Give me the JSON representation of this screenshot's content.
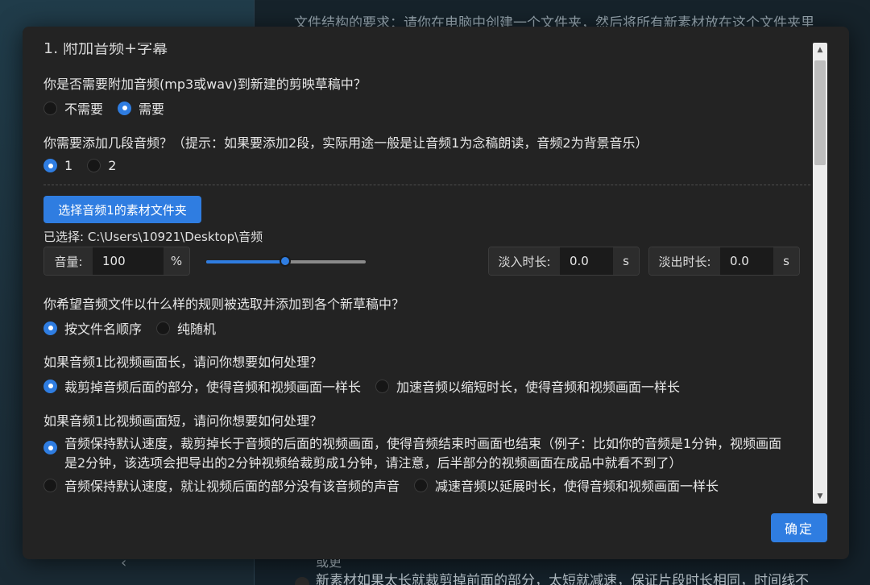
{
  "background": {
    "top_text": "文件结构的要求：请你在电脑中创建一个文件夹，然后将所有新素材放在这个文件夹里",
    "bottom_text_1": "或更",
    "bottom_text_2": "新素材如果太长就裁剪掉前面的部分，太短就减速，保证片段时长相同，时间线不"
  },
  "dialog": {
    "section_title": "1. 附加音频+字幕",
    "q_attach": "你是否需要附加音频(mp3或wav)到新建的剪映草稿中？",
    "attach_options": [
      {
        "label": "不需要",
        "selected": false
      },
      {
        "label": "需要",
        "selected": true
      }
    ],
    "q_count": "你需要添加几段音频？（提示：如果要添加2段，实际用途一般是让音频1为念稿朗读，音频2为背景音乐）",
    "count_options": [
      {
        "label": "1",
        "selected": true
      },
      {
        "label": "2",
        "selected": false
      }
    ],
    "select_folder_button": "选择音频1的素材文件夹",
    "selected_path": "已选择: C:\\Users\\10921\\Desktop\\音频",
    "volume": {
      "label": "音量:",
      "value": "100",
      "unit": "%",
      "slider_percent": 50
    },
    "fade_in": {
      "label": "淡入时长:",
      "value": "0.0",
      "unit": "s"
    },
    "fade_out": {
      "label": "淡出时长:",
      "value": "0.0",
      "unit": "s"
    },
    "q_rule": "你希望音频文件以什么样的规则被选取并添加到各个新草稿中？",
    "rule_options": [
      {
        "label": "按文件名顺序",
        "selected": true
      },
      {
        "label": "纯随机",
        "selected": false
      }
    ],
    "q_longer": "如果音频1比视频画面长，请问你想要如何处理？",
    "longer_options": [
      {
        "label": "裁剪掉音频后面的部分，使得音频和视频画面一样长",
        "selected": true
      },
      {
        "label": "加速音频以缩短时长，使得音频和视频画面一样长",
        "selected": false
      }
    ],
    "q_shorter": "如果音频1比视频画面短，请问你想要如何处理？",
    "shorter_long_option": {
      "label": "音频保持默认速度，裁剪掉长于音频的后面的视频画面，使得音频结束时画面也结束（例子：比如你的音频是1分钟，视频画面是2分钟，该选项会把导出的2分钟视频给裁剪成1分钟，请注意，后半部分的视频画面在成品中就看不到了）",
      "selected": true
    },
    "shorter_options": [
      {
        "label": "音频保持默认速度，就让视频后面的部分没有该音频的声音",
        "selected": false
      },
      {
        "label": "减速音频以延展时长，使得音频和视频画面一样长",
        "selected": false
      }
    ],
    "ok_button": "确定"
  }
}
